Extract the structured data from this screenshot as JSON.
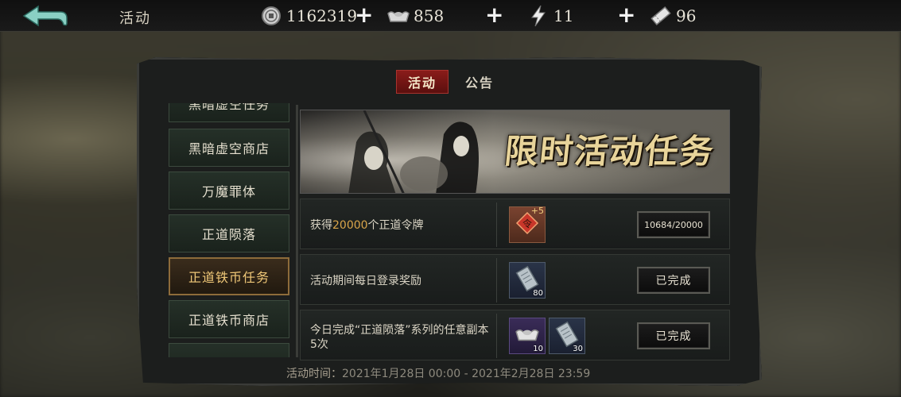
{
  "header": {
    "title": "活动",
    "resources": [
      {
        "icon": "coin-icon",
        "value": "1162319"
      },
      {
        "icon": "silver-ingot-icon",
        "value": "858"
      },
      {
        "icon": "lightning-icon",
        "value": "11"
      },
      {
        "icon": "ticket-icon",
        "value": "96"
      }
    ],
    "add_label": "+"
  },
  "tabs": [
    {
      "label": "活动",
      "active": true
    },
    {
      "label": "公告",
      "active": false
    }
  ],
  "sidebar": {
    "items": [
      {
        "label": "黑暗虚空任务",
        "active": false
      },
      {
        "label": "黑暗虚空商店",
        "active": false
      },
      {
        "label": "万魔罪体",
        "active": false
      },
      {
        "label": "正道陨落",
        "active": false
      },
      {
        "label": "正道铁币任务",
        "active": true
      },
      {
        "label": "正道铁币商店",
        "active": false
      }
    ]
  },
  "banner": {
    "title": "限时活动任务"
  },
  "tasks": [
    {
      "text_prefix": "获得",
      "text_highlight": "20000",
      "text_suffix": "个正道令牌",
      "rewards": [
        {
          "icon": "zhengdao-token-icon",
          "badge": "+5",
          "count": ""
        }
      ],
      "button": "10684/20000"
    },
    {
      "text_prefix": "活动期间每日登录奖励",
      "text_highlight": "",
      "text_suffix": "",
      "rewards": [
        {
          "icon": "iron-coin-icon",
          "badge": "",
          "count": "80"
        }
      ],
      "button": "已完成"
    },
    {
      "text_prefix": "今日完成“正道陨落”系列的任意副本5次",
      "text_highlight": "",
      "text_suffix": "",
      "rewards": [
        {
          "icon": "silver-ingot-icon",
          "badge": "",
          "count": "10"
        },
        {
          "icon": "iron-coin-icon",
          "badge": "",
          "count": "30"
        }
      ],
      "button": "已完成"
    }
  ],
  "event_time": {
    "label": "活动时间：",
    "value": "2021年1月28日 00:00 - 2021年2月28日 23:59"
  }
}
